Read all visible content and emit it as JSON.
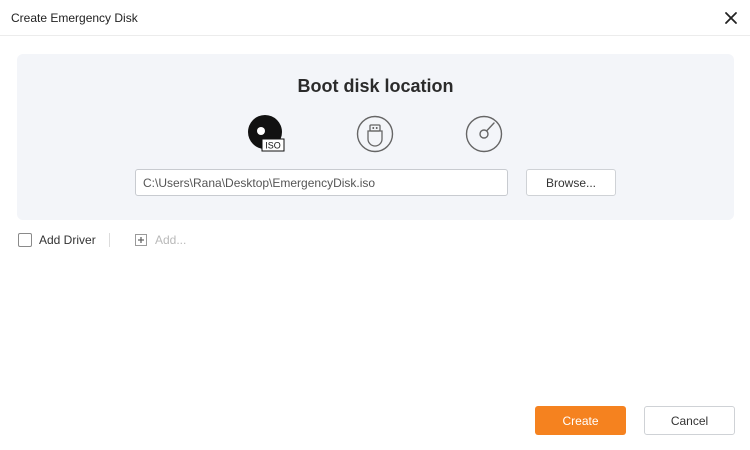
{
  "window": {
    "title": "Create Emergency Disk",
    "close_icon": "close-icon"
  },
  "boot": {
    "heading": "Boot disk location",
    "options": [
      {
        "name": "iso",
        "icon": "iso-disc-icon",
        "badge": "ISO",
        "selected": true
      },
      {
        "name": "usb",
        "icon": "usb-drive-icon",
        "selected": false
      },
      {
        "name": "cd",
        "icon": "cd-disc-icon",
        "selected": false
      }
    ],
    "path_value": "C:\\Users\\Rana\\Desktop\\EmergencyDisk.iso",
    "browse_label": "Browse..."
  },
  "driver": {
    "checkbox_label": "Add Driver",
    "checked": false,
    "add_label": "Add..."
  },
  "footer": {
    "create_label": "Create",
    "cancel_label": "Cancel"
  },
  "colors": {
    "accent": "#f5821f",
    "panel_bg": "#f3f5f9",
    "selected_icon": "#111111",
    "unselected_icon": "#666666"
  }
}
